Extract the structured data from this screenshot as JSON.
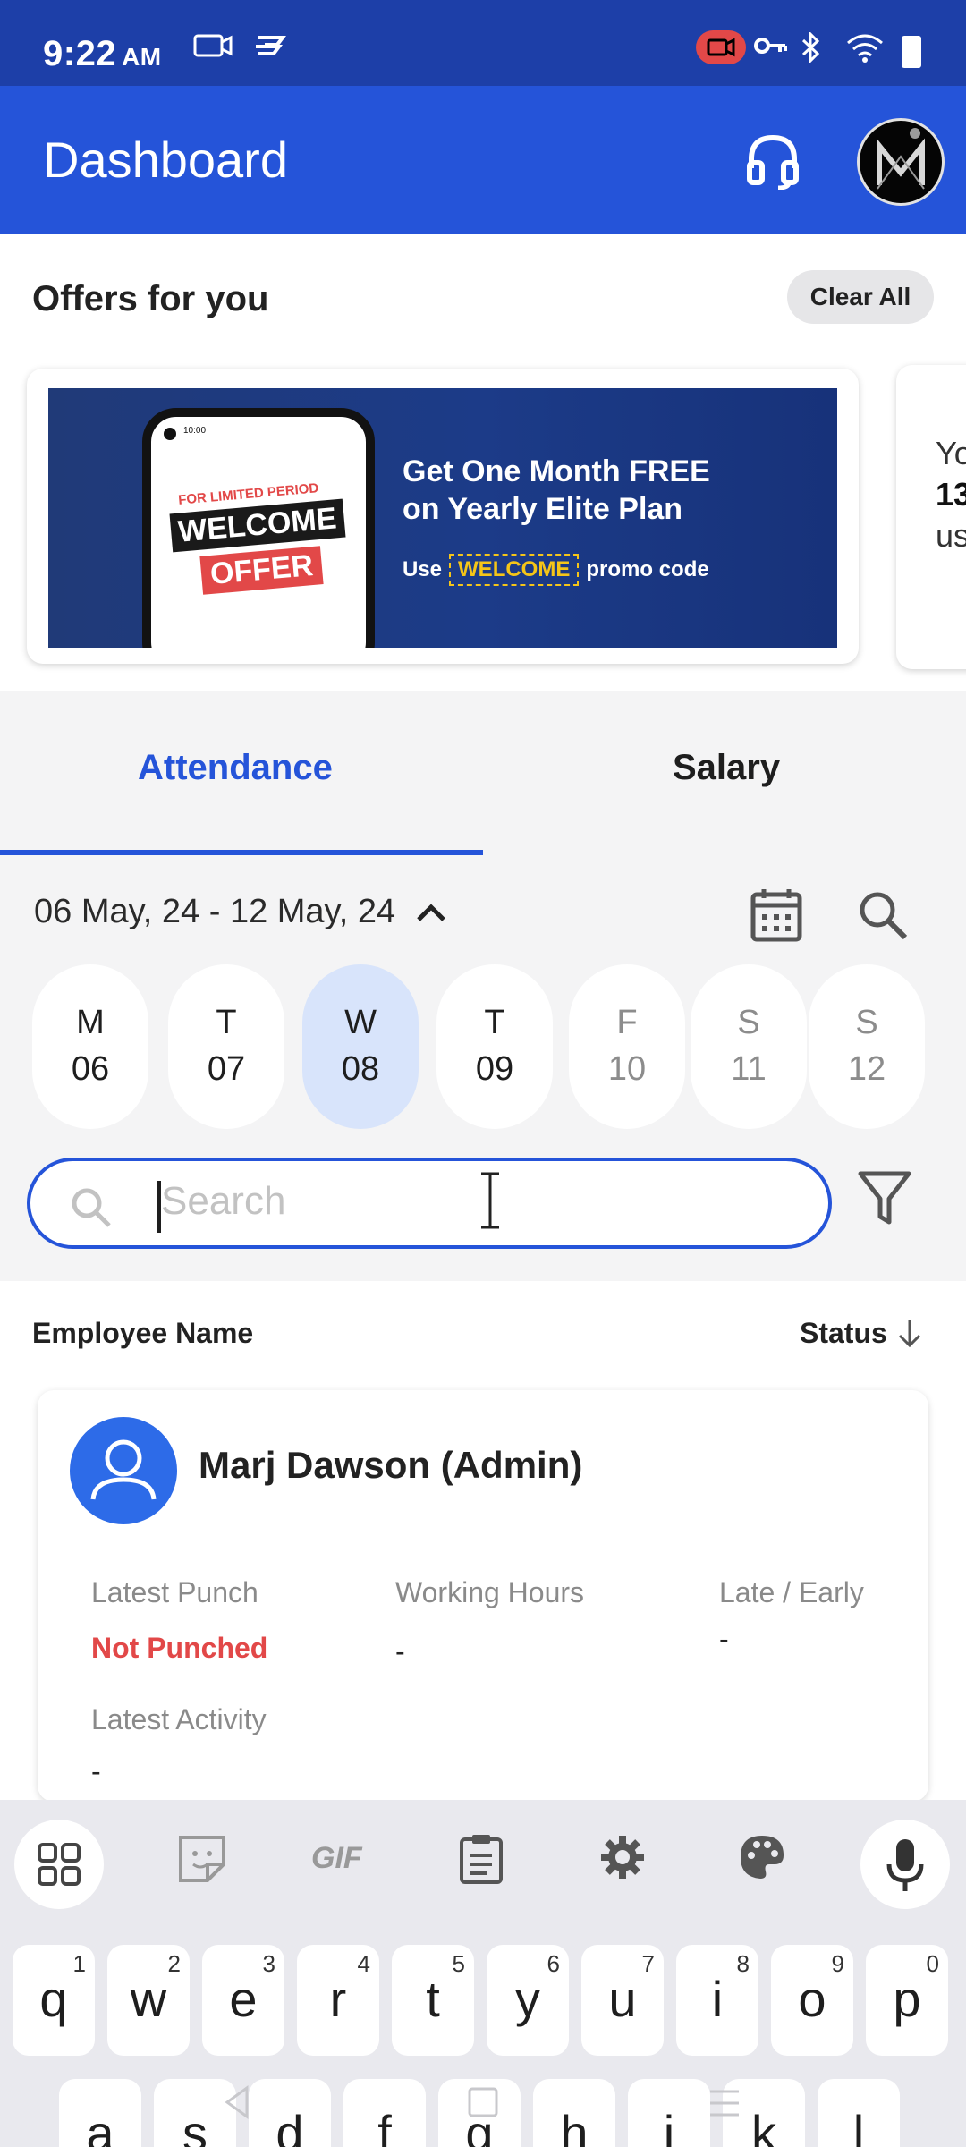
{
  "status_bar": {
    "time": "9:22",
    "ampm": "AM"
  },
  "app_bar": {
    "title": "Dashboard"
  },
  "offers": {
    "heading": "Offers for you",
    "clear_all": "Clear All",
    "banner": {
      "phone_time": "10:00",
      "limited": "FOR LIMITED PERIOD",
      "welcome": "WELCOME",
      "offer": "OFFER",
      "line1": "Get One Month FREE",
      "line2": "on Yearly Elite Plan",
      "promo_use": "Use",
      "promo_code": "WELCOME",
      "promo_suffix": "promo code"
    },
    "next_card": {
      "line1": "Yo",
      "line2": "13",
      "line3": "us"
    }
  },
  "tabs": {
    "attendance": "Attendance",
    "salary": "Salary"
  },
  "date_range": "06 May, 24 - 12 May, 24",
  "days": [
    {
      "letter": "M",
      "num": "06"
    },
    {
      "letter": "T",
      "num": "07"
    },
    {
      "letter": "W",
      "num": "08"
    },
    {
      "letter": "T",
      "num": "09"
    },
    {
      "letter": "F",
      "num": "10"
    },
    {
      "letter": "S",
      "num": "11"
    },
    {
      "letter": "S",
      "num": "12"
    }
  ],
  "search": {
    "placeholder": "Search",
    "value": ""
  },
  "list": {
    "col_name": "Employee Name",
    "col_status": "Status",
    "employees": [
      {
        "name": "Marj Dawson (Admin)",
        "latest_punch_label": "Latest Punch",
        "latest_punch": "Not Punched",
        "working_hours_label": "Working Hours",
        "working_hours": "-",
        "late_early_label": "Late / Early",
        "late_early": "-",
        "latest_activity_label": "Latest Activity",
        "latest_activity": "-"
      }
    ]
  },
  "keyboard": {
    "toolbar": [
      "apps-icon",
      "sticker-icon",
      "GIF",
      "clipboard-icon",
      "settings-icon",
      "palette-icon",
      "mic-icon"
    ],
    "row1": [
      {
        "k": "q",
        "n": "1"
      },
      {
        "k": "w",
        "n": "2"
      },
      {
        "k": "e",
        "n": "3"
      },
      {
        "k": "r",
        "n": "4"
      },
      {
        "k": "t",
        "n": "5"
      },
      {
        "k": "y",
        "n": "6"
      },
      {
        "k": "u",
        "n": "7"
      },
      {
        "k": "i",
        "n": "8"
      },
      {
        "k": "o",
        "n": "9"
      },
      {
        "k": "p",
        "n": "0"
      }
    ],
    "row2": [
      "a",
      "s",
      "d",
      "f",
      "g",
      "h",
      "j",
      "k",
      "l"
    ]
  },
  "colors": {
    "primary": "#2554d9",
    "status_bar": "#1d3fa8",
    "alert": "#e24848",
    "selected_day": "#d8e4fb"
  }
}
